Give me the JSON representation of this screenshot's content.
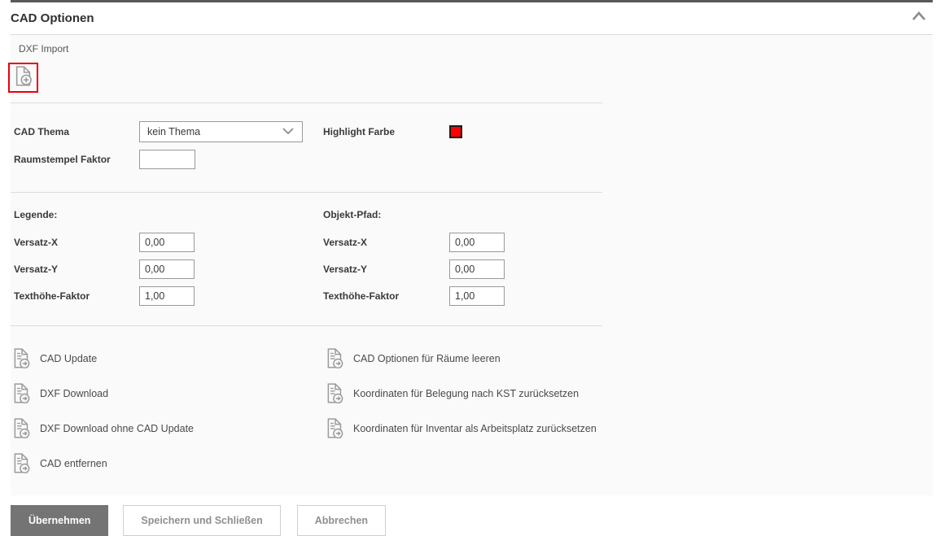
{
  "panel": {
    "title": "CAD Optionen"
  },
  "dxf_import": {
    "label": "DXF Import"
  },
  "cad_settings": {
    "cad_thema_label": "CAD Thema",
    "cad_thema_value": "kein Thema",
    "highlight_farbe_label": "Highlight Farbe",
    "raumstempel_label": "Raumstempel Faktor",
    "raumstempel_value": ""
  },
  "legende": {
    "heading": "Legende:",
    "versatz_x_label": "Versatz-X",
    "versatz_x_value": "0,00",
    "versatz_y_label": "Versatz-Y",
    "versatz_y_value": "0,00",
    "texthoehe_label": "Texthöhe-Faktor",
    "texthoehe_value": "1,00"
  },
  "objekt_pfad": {
    "heading": "Objekt-Pfad:",
    "versatz_x_label": "Versatz-X",
    "versatz_x_value": "0,00",
    "versatz_y_label": "Versatz-Y",
    "versatz_y_value": "0,00",
    "texthoehe_label": "Texthöhe-Faktor",
    "texthoehe_value": "1,00"
  },
  "actions": {
    "left": [
      {
        "label": "CAD Update"
      },
      {
        "label": "DXF Download"
      },
      {
        "label": "DXF Download ohne CAD Update"
      },
      {
        "label": "CAD entfernen"
      }
    ],
    "right": [
      {
        "label": "CAD Optionen für Räume leeren"
      },
      {
        "label": "Koordinaten für Belegung nach KST zurücksetzen"
      },
      {
        "label": "Koordinaten für Inventar als Arbeitsplatz zurücksetzen"
      }
    ]
  },
  "footer": {
    "apply_label": "Übernehmen",
    "save_close_label": "Speichern und Schließen",
    "cancel_label": "Abbrechen"
  },
  "colors": {
    "topbar": "#59595b",
    "body_background": "#fafafa",
    "highlight_swatch": "#ff0000",
    "dxf_import_focus_border": "#e8000d",
    "apply_button_bg": "#747474",
    "icon_gray": "#9b9b9b"
  }
}
